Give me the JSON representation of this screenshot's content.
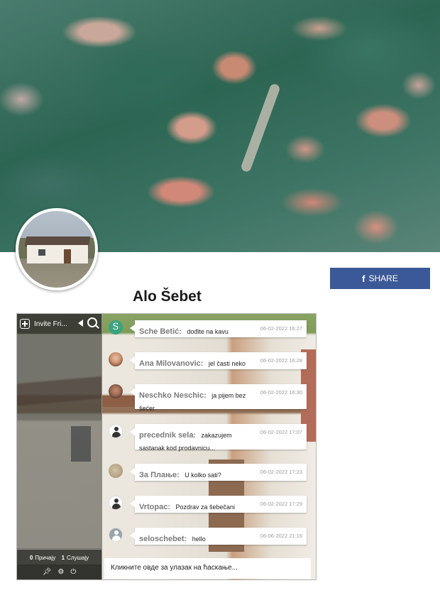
{
  "page": {
    "title": "Alo Šebet"
  },
  "share": {
    "icon": "facebook-icon",
    "icon_glyph": "f",
    "label": "SHARE",
    "color": "#3b5998"
  },
  "chat": {
    "sidebar": {
      "invite_label": "Invite Fri...",
      "status": {
        "talking_count": "0",
        "talking_label": "Причају",
        "listening_count": "1",
        "listening_label": "Слушају"
      },
      "icons": [
        "pin-icon",
        "gear-icon",
        "power-icon"
      ]
    },
    "messages": [
      {
        "user": "Sche Betić:",
        "text": "dođite na kavu",
        "time": "06-02-2022 16:27",
        "avatar": "letter-s-icon"
      },
      {
        "user": "Ana Milovanovic:",
        "text": "jel časti neko",
        "time": "06-02-2022 16:28",
        "avatar": "photo"
      },
      {
        "user": "Neschko Neschic:",
        "text": "ja pijem bez šećer",
        "time": "06-02-2022 16:30",
        "avatar": "photo"
      },
      {
        "user": "precednik sela:",
        "text": "zakazujem sastanak kod prodavnicu...",
        "time": "06-02-2022 17:07",
        "avatar": "user-icon"
      },
      {
        "user": "За Плање:",
        "text": "U kolko sati?",
        "time": "06-02-2022 17:23",
        "avatar": "photo"
      },
      {
        "user": "Vrtopac:",
        "text": "Pozdrav za šebečani",
        "time": "06-02-2022 17:29",
        "avatar": "user-icon"
      },
      {
        "user": "seloschebet:",
        "text": "hello",
        "time": "06-06-2022 21:16",
        "avatar": "user-icon"
      }
    ],
    "input_prompt": "Кликните овде за улазак на ћаскање..."
  }
}
